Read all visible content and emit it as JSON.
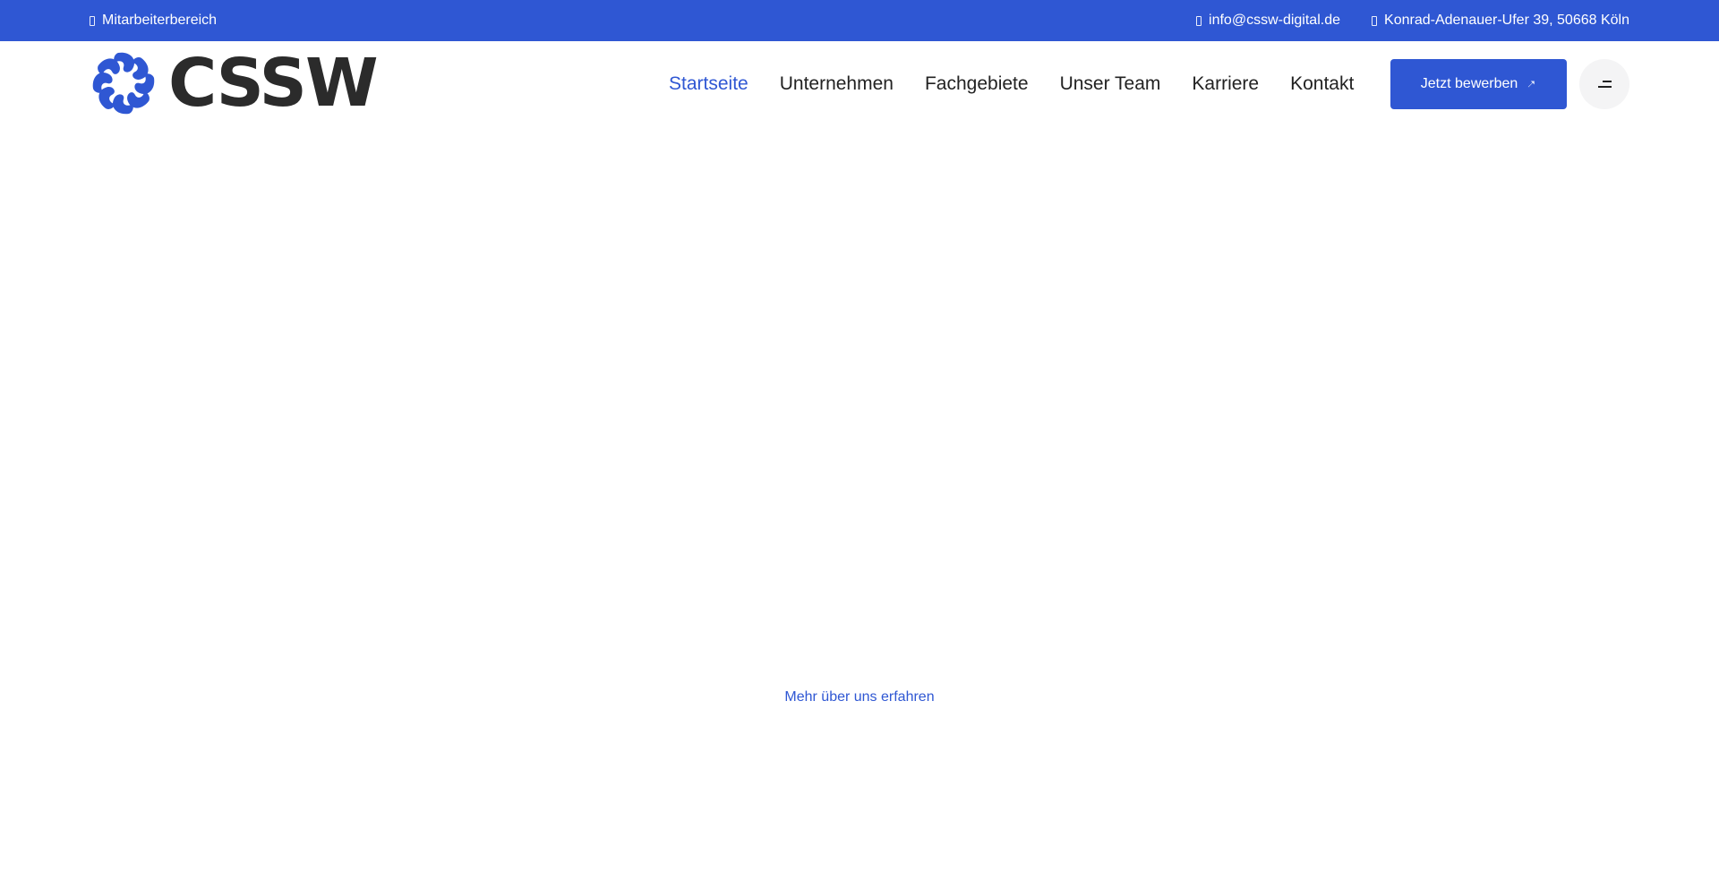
{
  "topbar": {
    "employee_area": "Mitarbeiterbereich",
    "employee_area_icon": "lock-icon",
    "email": "info@cssw-digital.de",
    "email_icon": "mail-icon",
    "address": "Konrad-Adenauer-Ufer 39, 50668 Köln",
    "address_icon": "map-pin-icon"
  },
  "header": {
    "logo_text": "CSSW",
    "nav": [
      {
        "label": "Startseite",
        "active": true
      },
      {
        "label": "Unternehmen",
        "active": false
      },
      {
        "label": "Fachgebiete",
        "active": false
      },
      {
        "label": "Unser Team",
        "active": false
      },
      {
        "label": "Karriere",
        "active": false
      },
      {
        "label": "Kontakt",
        "active": false
      }
    ],
    "apply_button": "Jetzt bewerben",
    "apply_icon": "arrow-up-right-icon",
    "menu_icon": "menu-icon"
  },
  "main": {
    "more_link": "Mehr über uns erfahren"
  },
  "colors": {
    "brand": "#2f57d3",
    "text_dark": "#222222",
    "logo_text": "#2b2b2b"
  }
}
